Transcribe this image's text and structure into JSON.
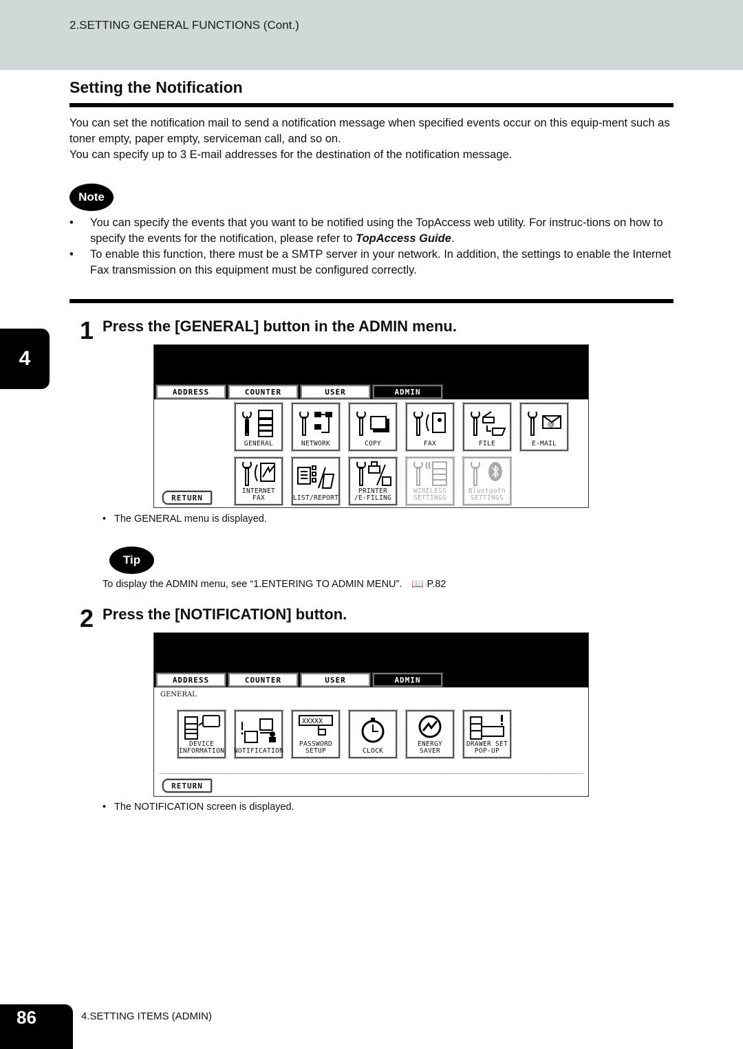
{
  "header": {
    "running_title": "2.SETTING GENERAL FUNCTIONS (Cont.)"
  },
  "section": {
    "title": "Setting the Notification",
    "intro": [
      "You can set the notification mail to send a notification message when specified events occur on this equip-ment such as toner empty, paper empty, serviceman call, and so on.",
      "You can specify up to 3 E-mail addresses for the destination of the notification message."
    ]
  },
  "note": {
    "badge": "Note",
    "items": [
      {
        "before": "You can specify the events that you want to be notified using the TopAccess web utility.  For instruc-tions on how to specify the events for the notification, please refer to ",
        "emph": "TopAccess Guide",
        "after": "."
      },
      {
        "before": "To enable this function, there must be a SMTP server in your network.  In addition, the settings to enable the Internet Fax transmission on this equipment must be configured correctly.",
        "emph": "",
        "after": ""
      }
    ]
  },
  "chapter_tab": "4",
  "steps": [
    {
      "number": "1",
      "text": "Press the [GENERAL] button in the ADMIN menu.",
      "screen": {
        "tabs": [
          "ADDRESS",
          "COUNTER",
          "USER",
          "ADMIN"
        ],
        "active_tab": "ADMIN",
        "buttons": [
          {
            "label": "GENERAL",
            "icon": "general-icon",
            "enabled": true
          },
          {
            "label": "NETWORK",
            "icon": "network-icon",
            "enabled": true
          },
          {
            "label": "COPY",
            "icon": "copy-icon",
            "enabled": true
          },
          {
            "label": "FAX",
            "icon": "fax-icon",
            "enabled": true
          },
          {
            "label": "FILE",
            "icon": "file-icon",
            "enabled": true
          },
          {
            "label": "E-MAIL",
            "icon": "email-icon",
            "enabled": true
          },
          {
            "label": "INTERNET FAX",
            "icon": "internet-fax-icon",
            "enabled": true
          },
          {
            "label": "LIST/REPORT",
            "icon": "list-report-icon",
            "enabled": true
          },
          {
            "label": "PRINTER\n/E-FILING",
            "icon": "printer-efiling-icon",
            "enabled": true
          },
          {
            "label": "WIRELESS\nSETTINGS",
            "icon": "wireless-icon",
            "enabled": false
          },
          {
            "label": "Bluetooth\nSETTINGS",
            "icon": "bluetooth-icon",
            "enabled": false
          }
        ],
        "return_label": "RETURN"
      },
      "caption": "The GENERAL menu is displayed."
    },
    {
      "number": "2",
      "text": "Press the [NOTIFICATION] button.",
      "screen": {
        "tabs": [
          "ADDRESS",
          "COUNTER",
          "USER",
          "ADMIN"
        ],
        "active_tab": "ADMIN",
        "breadcrumb": "GENERAL",
        "buttons": [
          {
            "label": "DEVICE\nINFORMATION",
            "icon": "device-info-icon",
            "enabled": true
          },
          {
            "label": "NOTIFICATION",
            "icon": "notification-icon",
            "enabled": true
          },
          {
            "label": "PASSWORD SETUP",
            "icon": "password-icon",
            "enabled": true
          },
          {
            "label": "CLOCK",
            "icon": "clock-icon",
            "enabled": true
          },
          {
            "label": "ENERGY\nSAVER",
            "icon": "energy-saver-icon",
            "enabled": true
          },
          {
            "label": "DRAWER SET\nPOP-UP",
            "icon": "drawer-icon",
            "enabled": true
          }
        ],
        "return_label": "RETURN"
      },
      "caption": "The NOTIFICATION screen is displayed."
    }
  ],
  "tip": {
    "badge": "Tip",
    "text": "To display the ADMIN menu, see “1.ENTERING TO ADMIN MENU”.",
    "ref_icon": "book-icon",
    "ref": "P.82"
  },
  "footer": {
    "page_number": "86",
    "chapter": "4.SETTING ITEMS (ADMIN)"
  }
}
